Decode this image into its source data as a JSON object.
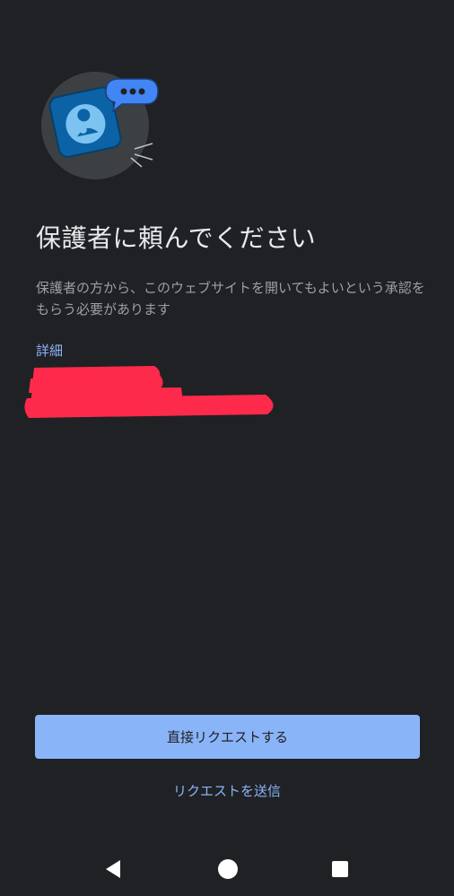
{
  "illustration": {
    "icon": "parent-request-icon",
    "colors": {
      "circle": "#3c4043",
      "card": "#0b63a6",
      "bubble": "#4285f4",
      "person": "#7cc3f2"
    }
  },
  "main": {
    "title": "保護者に頼んでください",
    "description": "保護者の方から、このウェブサイトを開いてもよいという承認をもらう必要があります",
    "details_link": "詳細"
  },
  "actions": {
    "primary_label": "直接リクエストする",
    "secondary_label": "リクエストを送信"
  },
  "navigation": {
    "icons": [
      "back-icon",
      "home-icon",
      "recents-icon"
    ]
  },
  "colors": {
    "background": "#202124",
    "accent": "#8ab4f8",
    "redaction": "#fe2a4b"
  }
}
